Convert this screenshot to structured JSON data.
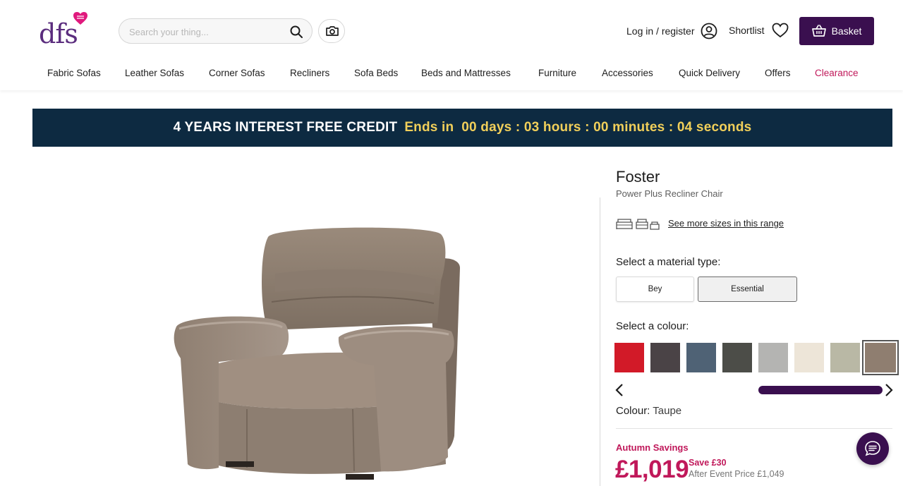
{
  "header": {
    "logo_text": "dfs",
    "search": {
      "placeholder": "Search your thing..."
    },
    "login_label": "Log in / register",
    "shortlist_label": "Shortlist",
    "basket_label": "Basket"
  },
  "nav": {
    "items": [
      "Fabric Sofas",
      "Leather Sofas",
      "Corner Sofas",
      "Recliners",
      "Sofa Beds",
      "Beds and Mattresses",
      "Furniture",
      "Accessories",
      "Quick Delivery",
      "Offers",
      "Clearance"
    ]
  },
  "promo": {
    "lead": "4 YEARS INTEREST FREE CREDIT",
    "countdown": "Ends in  00 days : 03 hours : 00 minutes : 04 seconds"
  },
  "product": {
    "title": "Foster",
    "subtitle": "Power Plus Recliner Chair",
    "sizes_link": "See more sizes in this range",
    "material_label": "Select a material type:",
    "materials": [
      "Bey",
      "Essential"
    ],
    "selected_material": "Essential",
    "colour_label": "Select a colour:",
    "swatches": [
      {
        "icon": "red-swatch",
        "color": "#d21a28"
      },
      {
        "icon": "charcoal-swatch",
        "color": "#4a4346"
      },
      {
        "icon": "slate-blue-swatch",
        "color": "#4f6275"
      },
      {
        "icon": "dark-grey-swatch",
        "color": "#4c4d48"
      },
      {
        "icon": "light-grey-swatch",
        "color": "#b4b4b2"
      },
      {
        "icon": "cream-swatch",
        "color": "#ede5d8"
      },
      {
        "icon": "sage-swatch",
        "color": "#b9b8a5"
      },
      {
        "icon": "taupe-swatch",
        "color": "#8f7e70"
      }
    ],
    "selected_colour_index": 7,
    "colour_prefix": "Colour:",
    "colour_value": "Taupe",
    "savings_label": "Autumn Savings",
    "price": "£1,019",
    "save_text": "Save £30",
    "after_event": "After Event Price £1,049"
  },
  "colors": {
    "brand_purple": "#3a0f4f",
    "promo_bg": "#0d2a41",
    "promo_accent": "#f1cf5a",
    "sale_pink": "#c0185a"
  }
}
